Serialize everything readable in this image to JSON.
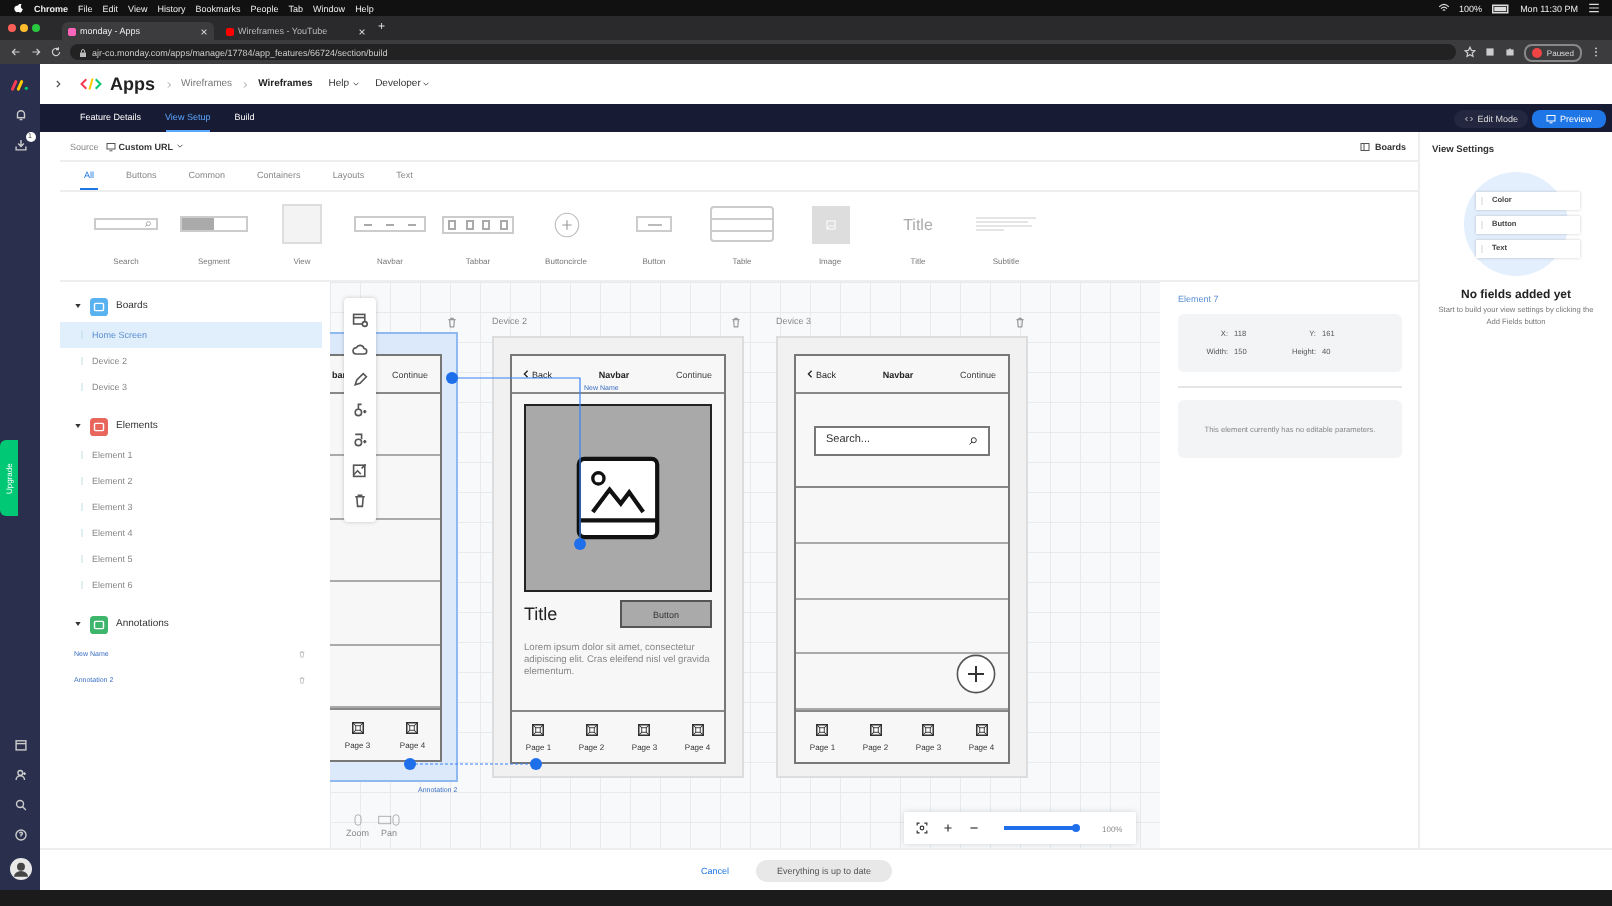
{
  "menu_bar": {
    "app": "Chrome",
    "items": [
      "File",
      "Edit",
      "View",
      "History",
      "Bookmarks",
      "People",
      "Tab",
      "Window",
      "Help"
    ],
    "battery": "100%",
    "clock": "Mon 11:30 PM"
  },
  "browser": {
    "tabs": [
      {
        "title": "monday - Apps",
        "selected": true
      },
      {
        "title": "Wireframes - YouTube",
        "selected": false
      }
    ],
    "new_tab": "+",
    "url": "ajr-co.monday.com/apps/manage/17784/app_features/66724/section/build",
    "profile": "Paused"
  },
  "sidebar": {
    "badge": "1",
    "upgrade": "Upgrade"
  },
  "header": {
    "title": "Apps",
    "breadcrumbs": [
      "Wireframes",
      "Wireframes"
    ],
    "menus": [
      "Help",
      "Developer"
    ]
  },
  "nav": {
    "tabs": [
      {
        "label": "Feature Details",
        "selected": false
      },
      {
        "label": "View Setup",
        "selected": true
      },
      {
        "label": "Build",
        "selected": false
      }
    ],
    "edit_mode": "Edit Mode",
    "preview": "Preview"
  },
  "source": {
    "label": "Source",
    "value": "Custom URL",
    "boards": "Boards"
  },
  "palette": {
    "tabs": [
      {
        "label": "All",
        "selected": true
      },
      {
        "label": "Buttons",
        "selected": false
      },
      {
        "label": "Common",
        "selected": false
      },
      {
        "label": "Containers",
        "selected": false
      },
      {
        "label": "Layouts",
        "selected": false
      },
      {
        "label": "Text",
        "selected": false
      }
    ],
    "components": [
      {
        "kind": "search",
        "label": "Search"
      },
      {
        "kind": "segment",
        "label": "Segment"
      },
      {
        "kind": "view",
        "label": "View"
      },
      {
        "kind": "navbar",
        "label": "Navbar"
      },
      {
        "kind": "tabbar",
        "label": "Tabbar"
      },
      {
        "kind": "buttoncircle",
        "label": "Buttoncircle"
      },
      {
        "kind": "button",
        "label": "Button"
      },
      {
        "kind": "table",
        "label": "Table"
      },
      {
        "kind": "image",
        "label": "Image"
      },
      {
        "kind": "title",
        "label": "Title",
        "sample": "Title"
      },
      {
        "kind": "subtitle",
        "label": "Subtitle"
      }
    ]
  },
  "tree": [
    {
      "kind": "list",
      "title": "Boards",
      "color": "#58b2f0",
      "expanded": true,
      "items": [
        {
          "label": "Home Screen",
          "selected": true
        },
        {
          "label": "Device 2",
          "selected": false
        },
        {
          "label": "Device 3",
          "selected": false
        }
      ]
    },
    {
      "kind": "list",
      "title": "Elements",
      "color": "#e8665c",
      "expanded": true,
      "items": [
        {
          "label": "Element 1",
          "selected": false
        },
        {
          "label": "Element 2",
          "selected": false
        },
        {
          "label": "Element 3",
          "selected": false
        },
        {
          "label": "Element 4",
          "selected": false
        },
        {
          "label": "Element 5",
          "selected": false
        },
        {
          "label": "Element 6",
          "selected": false
        }
      ]
    },
    {
      "kind": "annotations",
      "title": "Annotations",
      "color": "#3db56a",
      "expanded": true,
      "items": [
        {
          "label": "New Name",
          "selected": false
        },
        {
          "label": "Annotation 2",
          "selected": false
        }
      ]
    }
  ],
  "canvas": {
    "home_screen": {
      "selected": true,
      "navbar_title": "bar",
      "navbar_action": "Continue",
      "tabs": [
        "Page 3",
        "Page 4"
      ]
    },
    "device_2": {
      "label": "Device 2",
      "back": "Back",
      "title": "Navbar",
      "action": "Continue",
      "heading": "Title",
      "button": "Button",
      "body": "Lorem ipsum dolor sit amet, consectetur adipiscing elit. Cras eleifend nisl vel gravida elementum.",
      "tabs": [
        "Page 1",
        "Page 2",
        "Page 3",
        "Page 4"
      ]
    },
    "device_3": {
      "label": "Device 3",
      "back": "Back",
      "title": "Navbar",
      "action": "Continue",
      "search_text": "Search...",
      "tabs": [
        "Page 1",
        "Page 2",
        "Page 3",
        "Page 4"
      ]
    },
    "annotations": [
      "New Name",
      "Annotation 2"
    ],
    "hints": [
      "Zoom",
      "Pan"
    ],
    "zoom": {
      "level": 0.95,
      "reading": "100%"
    }
  },
  "inspector": {
    "title": "Element 7",
    "fields": [
      {
        "label": "X:",
        "value": "118"
      },
      {
        "label": "Y:",
        "value": "161"
      },
      {
        "label": "Width:",
        "value": "150"
      },
      {
        "label": "Height:",
        "value": "40"
      }
    ],
    "message": "This element currently has no editable parameters."
  },
  "view_settings": {
    "title": "View Settings",
    "cards": [
      "Color",
      "Button",
      "Text"
    ],
    "empty_title": "No fields added yet",
    "empty_text": "Start to build your view settings by clicking the Add Fields button"
  },
  "footer": {
    "cancel": "Cancel",
    "status": "Everything is up to date"
  }
}
